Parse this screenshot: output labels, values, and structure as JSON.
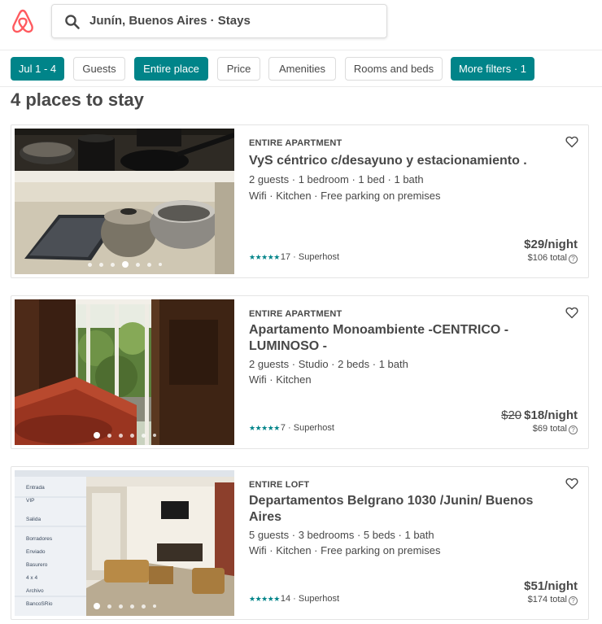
{
  "search": {
    "query": "Junín, Buenos Aires · Stays"
  },
  "filters": [
    {
      "label": "Jul 1 - 4",
      "active": true
    },
    {
      "label": "Guests",
      "active": false
    },
    {
      "label": "Entire place",
      "active": true
    },
    {
      "label": "Price",
      "active": false
    },
    {
      "label": "Amenities",
      "active": false
    },
    {
      "label": "Rooms and beds",
      "active": false
    },
    {
      "label": "More filters · 1",
      "active": true
    }
  ],
  "results_heading": "4 places to stay",
  "listings": [
    {
      "type": "ENTIRE APARTMENT",
      "title": "VyS céntrico c/desayuno y estacionamiento .",
      "details": "2 guests · 1 bedroom · 1 bed · 1 bath",
      "amenities": "Wifi · Kitchen · Free parking on premises",
      "stars": "★★★★★",
      "reviews": "17",
      "badge": " · Superhost",
      "old_price": "",
      "price": "$29/night",
      "total": "$106 total",
      "help": "?"
    },
    {
      "type": "ENTIRE APARTMENT",
      "title": "Apartamento Monoambiente -CENTRICO - LUMINOSO -",
      "details": "2 guests · Studio · 2 beds · 1 bath",
      "amenities": "Wifi · Kitchen",
      "stars": "★★★★★",
      "reviews": "7",
      "badge": " · Superhost",
      "old_price": "$20",
      "price": "$18/night",
      "total": "$69 total",
      "help": "?"
    },
    {
      "type": "ENTIRE LOFT",
      "title": "Departamentos Belgrano 1030 /Junin/ Buenos Aires",
      "details": "5 guests · 3 bedrooms · 5 beds · 1 bath",
      "amenities": "Wifi · Kitchen · Free parking on premises",
      "stars": "★★★★★",
      "reviews": "14",
      "badge": " · Superhost",
      "old_price": "",
      "price": "$51/night",
      "total": "$174 total",
      "help": "?",
      "photo_sidebar": [
        "Entrada",
        "VIP",
        "Salida",
        "Borradores",
        "Enviado",
        "Basurero",
        "4 x 4",
        "Archivo",
        "BancoSRio"
      ]
    }
  ],
  "colors": {
    "accent": "#008489",
    "brand": "#FF5A5F",
    "text": "#484848"
  }
}
